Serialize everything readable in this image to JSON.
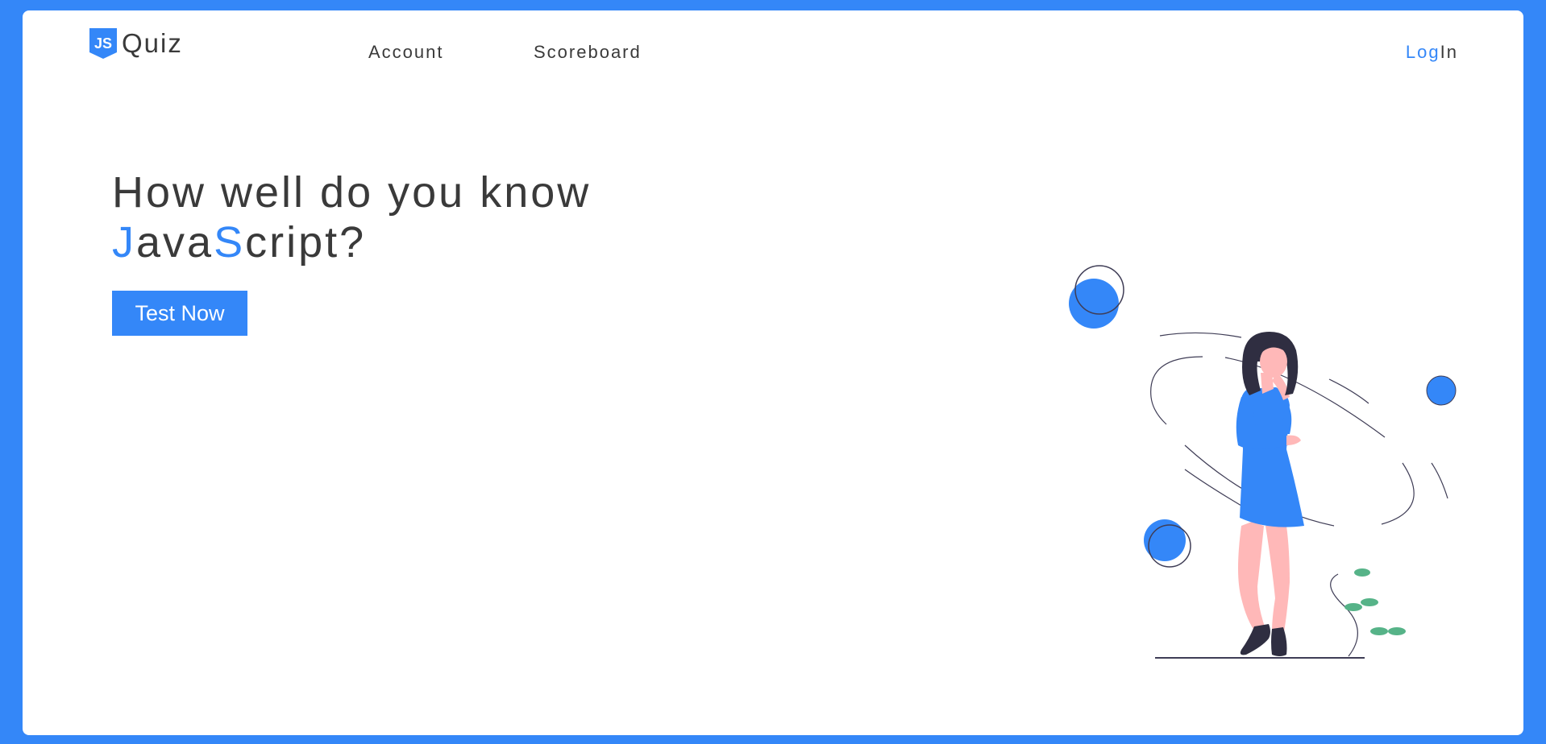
{
  "brand": {
    "logo_icon": "js-shield-icon",
    "name": "Quiz"
  },
  "nav": {
    "account": "Account",
    "scoreboard": "Scoreboard"
  },
  "auth": {
    "log": "Log",
    "in": "In"
  },
  "hero": {
    "line1": "How well do you know",
    "java_j": "J",
    "java_rest": "ava",
    "script_s": "S",
    "script_rest": "cript?",
    "cta_label": "Test Now"
  },
  "colors": {
    "accent": "#3487f8",
    "text": "#3a3a3a",
    "leaf": "#56b388",
    "skin": "#ffb8b8",
    "hair": "#2f2e41"
  },
  "illustration": {
    "name": "thinking-woman-illustration"
  }
}
